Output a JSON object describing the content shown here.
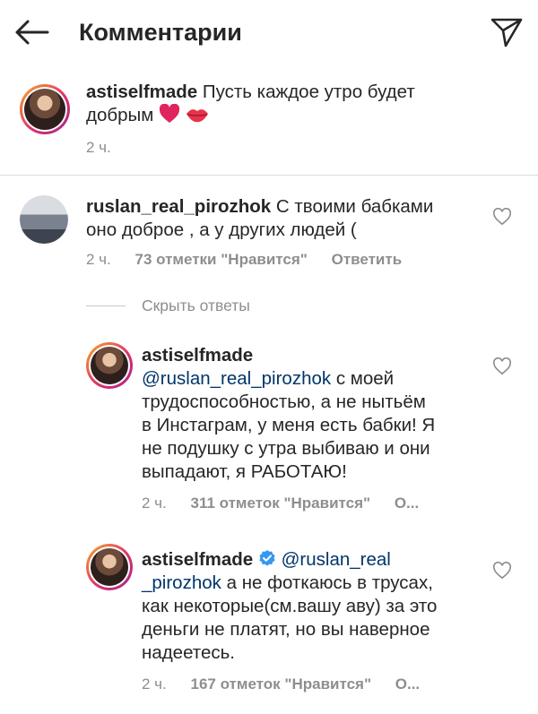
{
  "header": {
    "title": "Комментарии",
    "back_icon": "arrow-left-icon",
    "send_icon": "paper-plane-icon"
  },
  "caption": {
    "username": "astiselfmade",
    "line1": "Пусть каждое утро будет",
    "line2": "добрым",
    "emojis": [
      "heart-emoji",
      "kiss-lips-emoji"
    ],
    "time": "2 ч."
  },
  "comment": {
    "username": "ruslan_real_pirozhok",
    "line1": "С твоими бабками",
    "line2": "оно доброе , а у других людей (",
    "time": "2 ч.",
    "likes": "73 отметки \"Нравится\"",
    "reply_label": "Ответить"
  },
  "hide_replies": "Скрыть ответы",
  "replies": [
    {
      "username": "astiselfmade",
      "mention": "@ruslan_real_pirozhok",
      "line1_rest": "с моей",
      "lines": [
        "трудоспособностью, а не нытьём",
        "в Инстаграм, у меня есть бабки! Я",
        "не подушку с утра выбиваю и они",
        "выпадают, я РАБОТАЮ!"
      ],
      "time": "2 ч.",
      "likes": "311 отметок \"Нравится\"",
      "more": "О..."
    },
    {
      "username": "astiselfmade",
      "mention_a": "@ruslan_real",
      "mention_b": "_pirozhok",
      "line2_rest": "а не фоткаюсь в трусах,",
      "lines": [
        "как некоторые(см.вашу аву) за это",
        "деньги не платят, но вы наверное",
        "надеетесь."
      ],
      "time": "2 ч.",
      "likes": "167 отметок \"Нравится\"",
      "more": "О..."
    }
  ],
  "colors": {
    "text": "#262626",
    "muted": "#8e8e8e",
    "mention": "#003569",
    "verified": "#3897f0",
    "heart_emoji": "#ed4956"
  }
}
